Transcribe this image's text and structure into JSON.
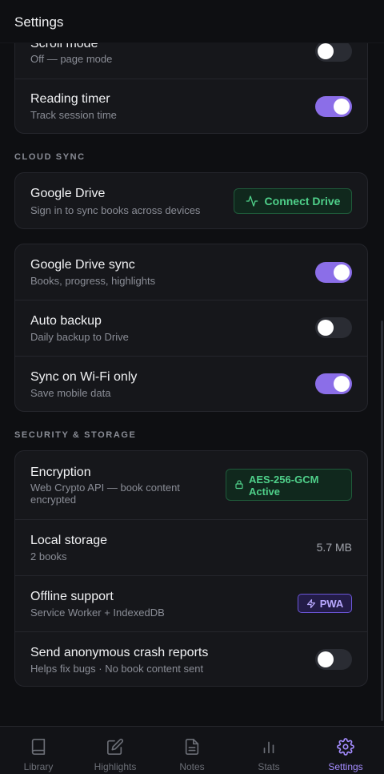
{
  "header": {
    "title": "Settings"
  },
  "reading": {
    "items": [
      {
        "label": "Scroll mode",
        "sub": "Off — page mode",
        "on": false
      },
      {
        "label": "Reading timer",
        "sub": "Track session time",
        "on": true
      }
    ]
  },
  "cloud": {
    "section_title": "CLOUD SYNC",
    "drive": {
      "label": "Google Drive",
      "sub": "Sign in to sync books across devices",
      "button": "Connect Drive"
    },
    "items": [
      {
        "label": "Google Drive sync",
        "sub": "Books, progress, highlights",
        "on": true
      },
      {
        "label": "Auto backup",
        "sub": "Daily backup to Drive",
        "on": false
      },
      {
        "label": "Sync on Wi-Fi only",
        "sub": "Save mobile data",
        "on": true
      }
    ]
  },
  "security": {
    "section_title": "SECURITY & STORAGE",
    "encryption": {
      "label": "Encryption",
      "sub_line1": "Web Crypto API — book content",
      "sub_line2": "encrypted",
      "badge_line1": "AES-256-GCM",
      "badge_line2": "Active"
    },
    "storage": {
      "label": "Local storage",
      "sub": "2 books",
      "value": "5.7 MB"
    },
    "offline": {
      "label": "Offline support",
      "sub": "Service Worker + IndexedDB",
      "badge": "PWA"
    },
    "crash": {
      "label": "Send anonymous crash reports",
      "sub": "Helps fix bugs · No book content sent",
      "on": false
    }
  },
  "nav": {
    "items": [
      {
        "label": "Library",
        "icon": "book-icon"
      },
      {
        "label": "Highlights",
        "icon": "edit-icon"
      },
      {
        "label": "Notes",
        "icon": "document-icon"
      },
      {
        "label": "Stats",
        "icon": "bar-chart-icon"
      },
      {
        "label": "Settings",
        "icon": "gear-icon",
        "active": true
      }
    ]
  },
  "colors": {
    "accent": "#8b6ee8",
    "green": "#4fd08a",
    "background": "#0e0f12",
    "card": "#16171b"
  }
}
